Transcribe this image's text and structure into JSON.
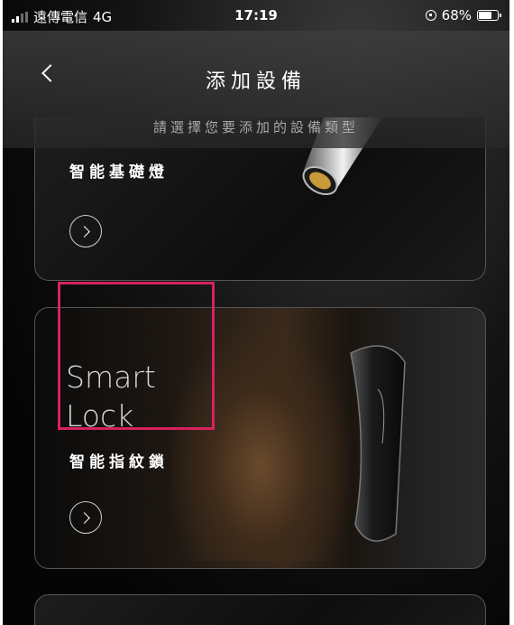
{
  "status_bar": {
    "carrier": "遠傳電信",
    "network": "4G",
    "time": "17:19",
    "battery": "68%",
    "battery_level": 0.68,
    "icons": [
      "signal-icon",
      "rotation-lock-icon",
      "battery-icon"
    ]
  },
  "header": {
    "title": "添加設備",
    "subtitle": "請選擇您要添加的設備類型",
    "back_icon": "chevron-left-icon"
  },
  "cards": [
    {
      "title_cn": "智能基礎燈",
      "arrow_icon": "chevron-right-icon"
    },
    {
      "title_en": "Smart Lock",
      "title_cn": "智能指紋鎖",
      "arrow_icon": "chevron-right-icon"
    }
  ],
  "colors": {
    "annotation": "#d6215f",
    "background": "#050505"
  }
}
